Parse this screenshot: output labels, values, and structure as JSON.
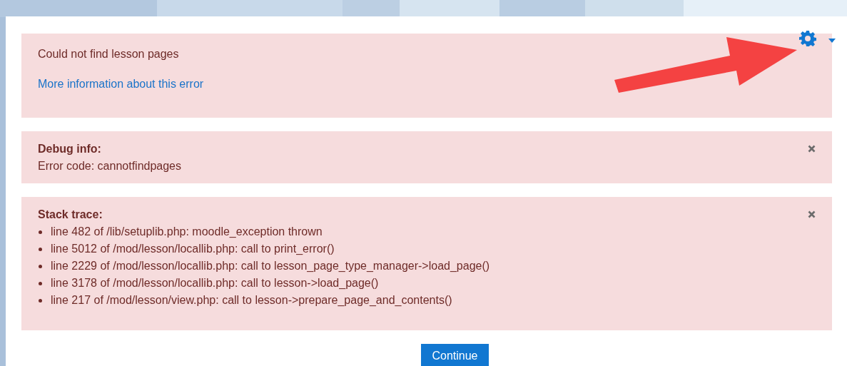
{
  "alerts": [
    {
      "kind": "message",
      "text": "Could not find lesson pages",
      "link": "More information about this error",
      "dismissible": false
    },
    {
      "kind": "debug",
      "title": "Debug info:",
      "text": "Error code: cannotfindpages",
      "dismissible": true
    },
    {
      "kind": "trace",
      "title": "Stack trace:",
      "items": [
        "line 482 of /lib/setuplib.php: moodle_exception thrown",
        "line 5012 of /mod/lesson/locallib.php: call to print_error()",
        "line 2229 of /mod/lesson/locallib.php: call to lesson_page_type_manager->load_page()",
        "line 3178 of /mod/lesson/locallib.php: call to lesson->load_page()",
        "line 217 of /mod/lesson/view.php: call to lesson->prepare_page_and_contents()"
      ],
      "dismissible": true
    }
  ],
  "button": {
    "label": "Continue"
  }
}
